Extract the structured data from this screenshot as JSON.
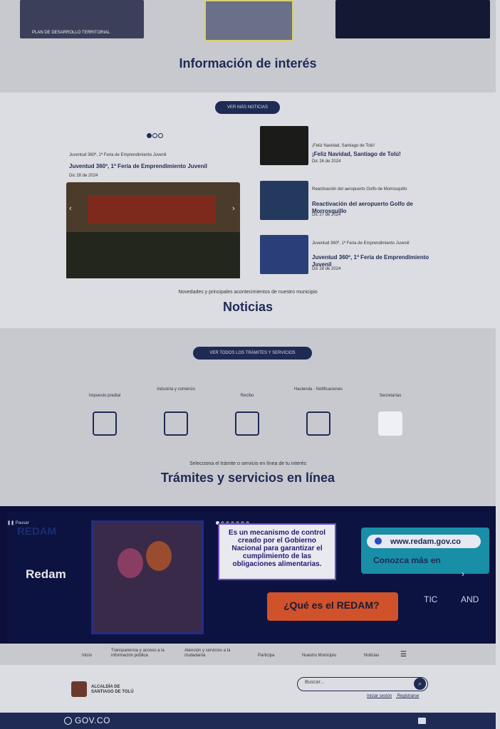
{
  "govco": {
    "logo": "GOV.CO"
  },
  "header": {
    "town_line1": "ALCALDÍA DE",
    "town_line2": "SANTIAGO DE TOLÚ",
    "search_placeholder": "Buscar...",
    "links": [
      "Iniciar sesión",
      "Registrarse"
    ]
  },
  "nav": {
    "items": [
      "Inicio",
      "Transparencia y acceso a la información pública",
      "Atención y servicios a la ciudadanía",
      "Participa",
      "Nuestro Municipio",
      "Noticias"
    ]
  },
  "banner": {
    "pause_label": "Pausar",
    "title": "Redam",
    "watermark_title": "REDAM",
    "card_text": "Es un mecanismo de control creado por el Gobierno Nacional para garantizar el cumplimiento de las obligaciones alimentarias.",
    "question": "¿Qué es el REDAM?",
    "conozca": "Conozca más en",
    "url": "www.redam.gov.co",
    "tic": "TIC",
    "and": "AND"
  },
  "tramites": {
    "title": "Trámites y servicios en línea",
    "subtitle": "Selecciona el trámite o servicio en línea de tu interés",
    "services": [
      {
        "label": "Impuesto predial",
        "icon": "house-tax-icon"
      },
      {
        "label": "Industria y comercio",
        "icon": "store-icon"
      },
      {
        "label": "Recibo",
        "icon": "receipt-icon"
      },
      {
        "label": "Hacienda - Notificaciones",
        "icon": "megaphone-icon"
      },
      {
        "label": "Secretarías",
        "icon": "puzzle-icon"
      }
    ],
    "button": "VER TODOS LOS TRÁMITES Y SERVICIOS"
  },
  "noticias": {
    "title": "Noticias",
    "subtitle": "Novedades y principales acontecimientos de nuestro municipio",
    "main": {
      "date": "Dic 28 de 2024",
      "headline": "Juventud 360º, 1ª Feria de Emprendimiento Juvenil",
      "desc": "Juventud 360º, 1ª Feria de Emprendimiento Juvenil"
    },
    "side": [
      {
        "date": "Dic 28 de 2024",
        "headline": "Juventud 360º, 1ª Feria de Emprendimiento Juvenil",
        "desc": "Juventud 360º, 1ª Feria de Emprendimiento Juvenil"
      },
      {
        "date": "Dic 27 de 2024",
        "headline": "Reactivación del aeropuerto Golfo de Morrosquillo",
        "desc": "Reactivación del aeropuerto Golfo de Morrosquillo"
      },
      {
        "date": "Dic 26 de 2024",
        "headline": "¡Feliz Navidad, Santiago de Tolú!",
        "desc": "¡Feliz Navidad, Santiago de Tolú!"
      }
    ],
    "button": "VER MÁS NOTICIAS"
  },
  "info": {
    "title": "Información de interés",
    "card1_caption": "PLAN DE DESARROLLO TERRITORIAL"
  },
  "colors": {
    "navy": "#1f2a55",
    "accent_orange": "#d0522a",
    "teal": "#188fa6"
  }
}
